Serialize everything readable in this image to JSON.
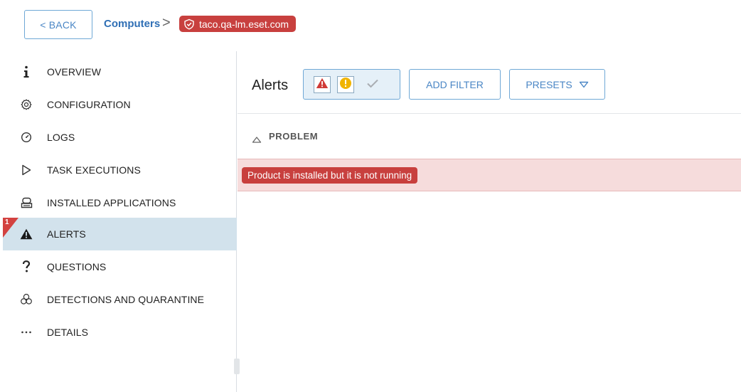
{
  "header": {
    "back_label": "< BACK",
    "breadcrumb_link": "Computers",
    "breadcrumb_separator": ">",
    "hostname": "taco.qa-lm.eset.com",
    "hostname_icon": "shield-check-icon"
  },
  "sidebar": {
    "items": [
      {
        "label": "OVERVIEW",
        "icon": "info-icon"
      },
      {
        "label": "CONFIGURATION",
        "icon": "gear-icon"
      },
      {
        "label": "LOGS",
        "icon": "clock-icon"
      },
      {
        "label": "TASK EXECUTIONS",
        "icon": "play-icon"
      },
      {
        "label": "INSTALLED APPLICATIONS",
        "icon": "installed-apps-icon"
      },
      {
        "label": "ALERTS",
        "icon": "warning-icon",
        "active": true,
        "badge": "1"
      },
      {
        "label": "QUESTIONS",
        "icon": "question-icon"
      },
      {
        "label": "DETECTIONS AND QUARANTINE",
        "icon": "biohazard-icon"
      },
      {
        "label": "DETAILS",
        "icon": "ellipsis-icon"
      }
    ]
  },
  "main": {
    "title": "Alerts",
    "severity_filters": [
      {
        "name": "critical",
        "icon": "warning-triangle-icon",
        "selected": true
      },
      {
        "name": "warning",
        "icon": "exclamation-circle-icon",
        "selected": true
      },
      {
        "name": "ok",
        "icon": "check-icon",
        "selected": false
      }
    ],
    "add_filter_label": "ADD FILTER",
    "presets_label": "PRESETS",
    "column_header": "PROBLEM",
    "rows": [
      {
        "problem": "Product is installed but it is not running"
      }
    ]
  },
  "colors": {
    "accent_blue": "#4a86c5",
    "alert_red": "#c8403e",
    "active_nav_bg": "#d2e2ec",
    "alert_row_bg": "#f6dcdc",
    "warning_yellow": "#f0b400"
  }
}
